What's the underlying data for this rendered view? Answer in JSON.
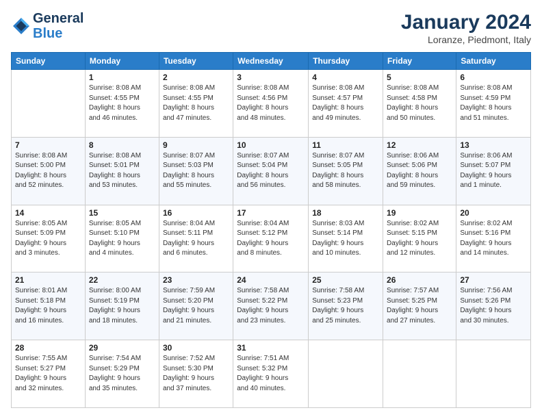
{
  "header": {
    "logo_line1": "General",
    "logo_line2": "Blue",
    "month": "January 2024",
    "location": "Loranze, Piedmont, Italy"
  },
  "weekdays": [
    "Sunday",
    "Monday",
    "Tuesday",
    "Wednesday",
    "Thursday",
    "Friday",
    "Saturday"
  ],
  "weeks": [
    [
      {
        "day": "",
        "info": ""
      },
      {
        "day": "1",
        "info": "Sunrise: 8:08 AM\nSunset: 4:55 PM\nDaylight: 8 hours\nand 46 minutes."
      },
      {
        "day": "2",
        "info": "Sunrise: 8:08 AM\nSunset: 4:55 PM\nDaylight: 8 hours\nand 47 minutes."
      },
      {
        "day": "3",
        "info": "Sunrise: 8:08 AM\nSunset: 4:56 PM\nDaylight: 8 hours\nand 48 minutes."
      },
      {
        "day": "4",
        "info": "Sunrise: 8:08 AM\nSunset: 4:57 PM\nDaylight: 8 hours\nand 49 minutes."
      },
      {
        "day": "5",
        "info": "Sunrise: 8:08 AM\nSunset: 4:58 PM\nDaylight: 8 hours\nand 50 minutes."
      },
      {
        "day": "6",
        "info": "Sunrise: 8:08 AM\nSunset: 4:59 PM\nDaylight: 8 hours\nand 51 minutes."
      }
    ],
    [
      {
        "day": "7",
        "info": "Sunrise: 8:08 AM\nSunset: 5:00 PM\nDaylight: 8 hours\nand 52 minutes."
      },
      {
        "day": "8",
        "info": "Sunrise: 8:08 AM\nSunset: 5:01 PM\nDaylight: 8 hours\nand 53 minutes."
      },
      {
        "day": "9",
        "info": "Sunrise: 8:07 AM\nSunset: 5:03 PM\nDaylight: 8 hours\nand 55 minutes."
      },
      {
        "day": "10",
        "info": "Sunrise: 8:07 AM\nSunset: 5:04 PM\nDaylight: 8 hours\nand 56 minutes."
      },
      {
        "day": "11",
        "info": "Sunrise: 8:07 AM\nSunset: 5:05 PM\nDaylight: 8 hours\nand 58 minutes."
      },
      {
        "day": "12",
        "info": "Sunrise: 8:06 AM\nSunset: 5:06 PM\nDaylight: 8 hours\nand 59 minutes."
      },
      {
        "day": "13",
        "info": "Sunrise: 8:06 AM\nSunset: 5:07 PM\nDaylight: 9 hours\nand 1 minute."
      }
    ],
    [
      {
        "day": "14",
        "info": "Sunrise: 8:05 AM\nSunset: 5:09 PM\nDaylight: 9 hours\nand 3 minutes."
      },
      {
        "day": "15",
        "info": "Sunrise: 8:05 AM\nSunset: 5:10 PM\nDaylight: 9 hours\nand 4 minutes."
      },
      {
        "day": "16",
        "info": "Sunrise: 8:04 AM\nSunset: 5:11 PM\nDaylight: 9 hours\nand 6 minutes."
      },
      {
        "day": "17",
        "info": "Sunrise: 8:04 AM\nSunset: 5:12 PM\nDaylight: 9 hours\nand 8 minutes."
      },
      {
        "day": "18",
        "info": "Sunrise: 8:03 AM\nSunset: 5:14 PM\nDaylight: 9 hours\nand 10 minutes."
      },
      {
        "day": "19",
        "info": "Sunrise: 8:02 AM\nSunset: 5:15 PM\nDaylight: 9 hours\nand 12 minutes."
      },
      {
        "day": "20",
        "info": "Sunrise: 8:02 AM\nSunset: 5:16 PM\nDaylight: 9 hours\nand 14 minutes."
      }
    ],
    [
      {
        "day": "21",
        "info": "Sunrise: 8:01 AM\nSunset: 5:18 PM\nDaylight: 9 hours\nand 16 minutes."
      },
      {
        "day": "22",
        "info": "Sunrise: 8:00 AM\nSunset: 5:19 PM\nDaylight: 9 hours\nand 18 minutes."
      },
      {
        "day": "23",
        "info": "Sunrise: 7:59 AM\nSunset: 5:20 PM\nDaylight: 9 hours\nand 21 minutes."
      },
      {
        "day": "24",
        "info": "Sunrise: 7:58 AM\nSunset: 5:22 PM\nDaylight: 9 hours\nand 23 minutes."
      },
      {
        "day": "25",
        "info": "Sunrise: 7:58 AM\nSunset: 5:23 PM\nDaylight: 9 hours\nand 25 minutes."
      },
      {
        "day": "26",
        "info": "Sunrise: 7:57 AM\nSunset: 5:25 PM\nDaylight: 9 hours\nand 27 minutes."
      },
      {
        "day": "27",
        "info": "Sunrise: 7:56 AM\nSunset: 5:26 PM\nDaylight: 9 hours\nand 30 minutes."
      }
    ],
    [
      {
        "day": "28",
        "info": "Sunrise: 7:55 AM\nSunset: 5:27 PM\nDaylight: 9 hours\nand 32 minutes."
      },
      {
        "day": "29",
        "info": "Sunrise: 7:54 AM\nSunset: 5:29 PM\nDaylight: 9 hours\nand 35 minutes."
      },
      {
        "day": "30",
        "info": "Sunrise: 7:52 AM\nSunset: 5:30 PM\nDaylight: 9 hours\nand 37 minutes."
      },
      {
        "day": "31",
        "info": "Sunrise: 7:51 AM\nSunset: 5:32 PM\nDaylight: 9 hours\nand 40 minutes."
      },
      {
        "day": "",
        "info": ""
      },
      {
        "day": "",
        "info": ""
      },
      {
        "day": "",
        "info": ""
      }
    ]
  ]
}
